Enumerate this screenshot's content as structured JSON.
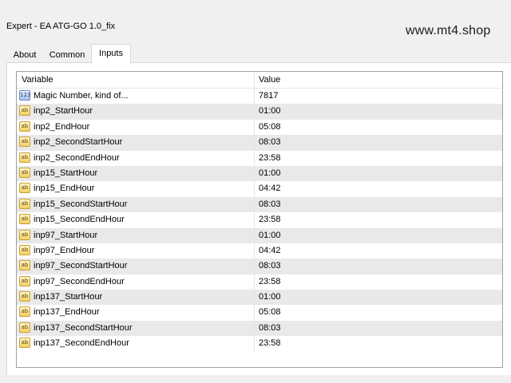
{
  "window": {
    "title": "Expert - EA ATG-GO 1.0_fix",
    "watermark": "www.mt4.shop"
  },
  "tabs": [
    {
      "label": "About",
      "active": false
    },
    {
      "label": "Common",
      "active": false
    },
    {
      "label": "Inputs",
      "active": true
    }
  ],
  "table": {
    "columns": {
      "variable": "Variable",
      "value": "Value"
    },
    "rows": [
      {
        "icon": "number-icon",
        "icon_text": "123",
        "name": "Magic Number, kind of...",
        "value": "7817"
      },
      {
        "icon": "string-icon",
        "icon_text": "ab",
        "name": "inp2_StartHour",
        "value": "01:00"
      },
      {
        "icon": "string-icon",
        "icon_text": "ab",
        "name": "inp2_EndHour",
        "value": "05:08"
      },
      {
        "icon": "string-icon",
        "icon_text": "ab",
        "name": "inp2_SecondStartHour",
        "value": "08:03"
      },
      {
        "icon": "string-icon",
        "icon_text": "ab",
        "name": "inp2_SecondEndHour",
        "value": "23:58"
      },
      {
        "icon": "string-icon",
        "icon_text": "ab",
        "name": "inp15_StartHour",
        "value": "01:00"
      },
      {
        "icon": "string-icon",
        "icon_text": "ab",
        "name": "inp15_EndHour",
        "value": "04:42"
      },
      {
        "icon": "string-icon",
        "icon_text": "ab",
        "name": "inp15_SecondStartHour",
        "value": "08:03"
      },
      {
        "icon": "string-icon",
        "icon_text": "ab",
        "name": "inp15_SecondEndHour",
        "value": "23:58"
      },
      {
        "icon": "string-icon",
        "icon_text": "ab",
        "name": "inp97_StartHour",
        "value": "01:00"
      },
      {
        "icon": "string-icon",
        "icon_text": "ab",
        "name": "inp97_EndHour",
        "value": "04:42"
      },
      {
        "icon": "string-icon",
        "icon_text": "ab",
        "name": "inp97_SecondStartHour",
        "value": "08:03"
      },
      {
        "icon": "string-icon",
        "icon_text": "ab",
        "name": "inp97_SecondEndHour",
        "value": "23:58"
      },
      {
        "icon": "string-icon",
        "icon_text": "ab",
        "name": "inp137_StartHour",
        "value": "01:00"
      },
      {
        "icon": "string-icon",
        "icon_text": "ab",
        "name": "inp137_EndHour",
        "value": "05:08"
      },
      {
        "icon": "string-icon",
        "icon_text": "ab",
        "name": "inp137_SecondStartHour",
        "value": "08:03"
      },
      {
        "icon": "string-icon",
        "icon_text": "ab",
        "name": "inp137_SecondEndHour",
        "value": "23:58"
      }
    ]
  }
}
